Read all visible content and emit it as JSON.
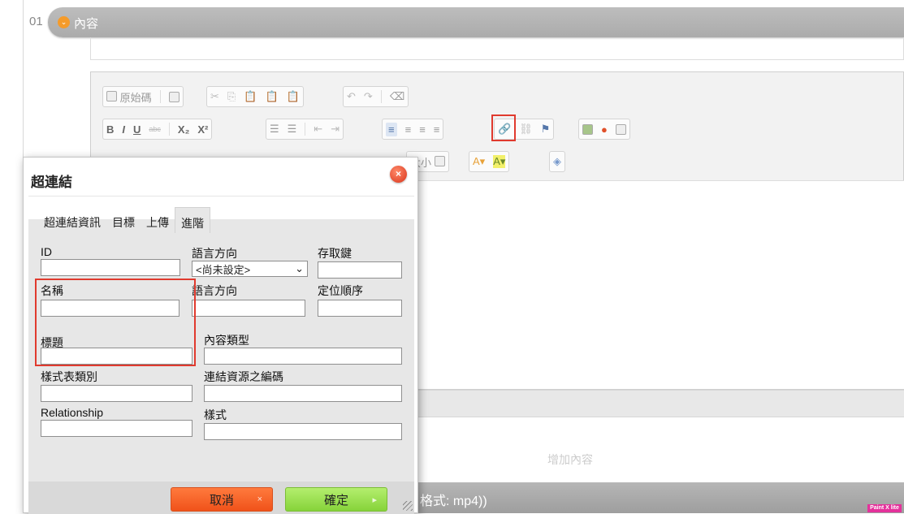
{
  "page": {
    "row_number": "01",
    "section_title": "內容",
    "add_content": "增加內容",
    "bottom_bar_text": "格式: mp4))",
    "badge": "Paint X lite"
  },
  "toolbar": {
    "source_label": "原始碼",
    "font_size_label": "大小",
    "row2_items": [
      "B",
      "I",
      "U",
      "abc",
      "X₂",
      "X²"
    ]
  },
  "dialog": {
    "title": "超連結",
    "close_glyph": "×",
    "tabs": [
      {
        "label": "超連結資訊",
        "active": false
      },
      {
        "label": "目標",
        "active": false
      },
      {
        "label": "上傳",
        "active": false
      },
      {
        "label": "進階",
        "active": true
      }
    ],
    "fields": {
      "id": {
        "label": "ID",
        "value": ""
      },
      "lang_dir": {
        "label": "語言方向",
        "value": "<尚未設定>"
      },
      "access_key": {
        "label": "存取鍵",
        "value": ""
      },
      "name": {
        "label": "名稱",
        "value": ""
      },
      "lang_dir2": {
        "label": "語言方向",
        "value": ""
      },
      "tab_index": {
        "label": "定位順序",
        "value": ""
      },
      "title": {
        "label": "標題",
        "value": ""
      },
      "content_type": {
        "label": "內容類型",
        "value": ""
      },
      "stylesheet_class": {
        "label": "樣式表類別",
        "value": ""
      },
      "charset": {
        "label": "連結資源之編碼",
        "value": ""
      },
      "relationship": {
        "label": "Relationship",
        "value": ""
      },
      "style": {
        "label": "樣式",
        "value": ""
      }
    },
    "buttons": {
      "cancel": "取消",
      "cancel_glyph": "×",
      "ok": "確定",
      "ok_glyph": "▸"
    }
  },
  "colors": {
    "highlight": "#e03a2e",
    "cancel": "#f0521a",
    "ok": "#86d33a"
  }
}
